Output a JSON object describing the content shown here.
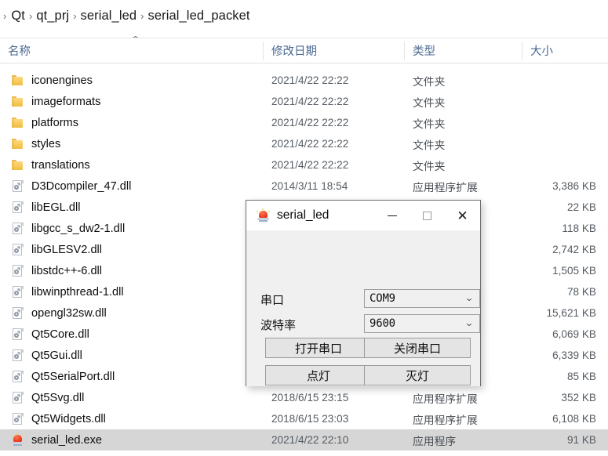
{
  "breadcrumb": {
    "separator": "›",
    "items": [
      "Qt",
      "qt_prj",
      "serial_led",
      "serial_led_packet"
    ]
  },
  "columns": {
    "name": "名称",
    "date": "修改日期",
    "type": "类型",
    "size": "大小",
    "sort_caret": "⌃"
  },
  "files": [
    {
      "name": "iconengines",
      "icon": "folder-icon",
      "date": "2021/4/22 22:22",
      "type": "文件夹",
      "size": "",
      "selected": false
    },
    {
      "name": "imageformats",
      "icon": "folder-icon",
      "date": "2021/4/22 22:22",
      "type": "文件夹",
      "size": "",
      "selected": false
    },
    {
      "name": "platforms",
      "icon": "folder-icon",
      "date": "2021/4/22 22:22",
      "type": "文件夹",
      "size": "",
      "selected": false
    },
    {
      "name": "styles",
      "icon": "folder-icon",
      "date": "2021/4/22 22:22",
      "type": "文件夹",
      "size": "",
      "selected": false
    },
    {
      "name": "translations",
      "icon": "folder-icon",
      "date": "2021/4/22 22:22",
      "type": "文件夹",
      "size": "",
      "selected": false
    },
    {
      "name": "D3Dcompiler_47.dll",
      "icon": "dll-icon",
      "date": "2014/3/11 18:54",
      "type": "应用程序扩展",
      "size": "3,386 KB",
      "selected": false
    },
    {
      "name": "libEGL.dll",
      "icon": "dll-icon",
      "date": "",
      "type": "",
      "size": "22 KB",
      "selected": false
    },
    {
      "name": "libgcc_s_dw2-1.dll",
      "icon": "dll-icon",
      "date": "",
      "type": "",
      "size": "118 KB",
      "selected": false
    },
    {
      "name": "libGLESV2.dll",
      "icon": "dll-icon",
      "date": "",
      "type": "",
      "size": "2,742 KB",
      "selected": false
    },
    {
      "name": "libstdc++-6.dll",
      "icon": "dll-icon",
      "date": "",
      "type": "",
      "size": "1,505 KB",
      "selected": false
    },
    {
      "name": "libwinpthread-1.dll",
      "icon": "dll-icon",
      "date": "",
      "type": "",
      "size": "78 KB",
      "selected": false
    },
    {
      "name": "opengl32sw.dll",
      "icon": "dll-icon",
      "date": "",
      "type": "",
      "size": "15,621 KB",
      "selected": false
    },
    {
      "name": "Qt5Core.dll",
      "icon": "dll-icon",
      "date": "",
      "type": "",
      "size": "6,069 KB",
      "selected": false
    },
    {
      "name": "Qt5Gui.dll",
      "icon": "dll-icon",
      "date": "",
      "type": "",
      "size": "6,339 KB",
      "selected": false
    },
    {
      "name": "Qt5SerialPort.dll",
      "icon": "dll-icon",
      "date": "",
      "type": "",
      "size": "85 KB",
      "selected": false
    },
    {
      "name": "Qt5Svg.dll",
      "icon": "dll-icon",
      "date": "2018/6/15 23:15",
      "type": "应用程序扩展",
      "size": "352 KB",
      "selected": false
    },
    {
      "name": "Qt5Widgets.dll",
      "icon": "dll-icon",
      "date": "2018/6/15 23:03",
      "type": "应用程序扩展",
      "size": "6,108 KB",
      "selected": false
    },
    {
      "name": "serial_led.exe",
      "icon": "app-icon",
      "date": "2021/4/22 22:10",
      "type": "应用程序",
      "size": "91 KB",
      "selected": true
    }
  ],
  "dialog": {
    "title": "serial_led",
    "icon": "siren-light-icon",
    "minimize_glyph": "—",
    "maximize_glyph": "□",
    "close_glyph": "✕",
    "port_label": "串口",
    "port_value": "COM9",
    "baud_label": "波特率",
    "baud_value": "9600",
    "chevron": "⌄",
    "btn_open_port": "打开串口",
    "btn_close_port": "关闭串口",
    "btn_light_on": "点灯",
    "btn_light_off": "灭灯"
  },
  "colors": {
    "header_text": "#4a6a91",
    "selection": "#d6d6d6",
    "dialog_bg": "#f0f0f0",
    "folder": "#f7c959",
    "app_icon": "#e8331a"
  }
}
